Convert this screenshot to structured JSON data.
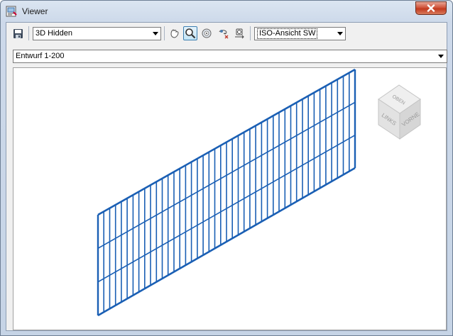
{
  "window": {
    "title": "Viewer"
  },
  "toolbar": {
    "visual_style": "3D Hidden",
    "view_direction": "ISO-Ansicht SW",
    "buttons": [
      {
        "icon": "save-icon"
      },
      {
        "icon": "pan-icon"
      },
      {
        "icon": "zoom-icon"
      },
      {
        "icon": "orbit-icon"
      },
      {
        "icon": "zoom-extents-icon"
      },
      {
        "icon": "camera-icon"
      }
    ]
  },
  "scale_select": {
    "value": "Entwurf 1-200"
  },
  "viewcube": {
    "top": "OBEN",
    "left": "LINKS",
    "front": "VORNE"
  },
  "model": {
    "color": "#1a5fb4",
    "vertical_bars": 44,
    "horizontal_rails": 4
  }
}
